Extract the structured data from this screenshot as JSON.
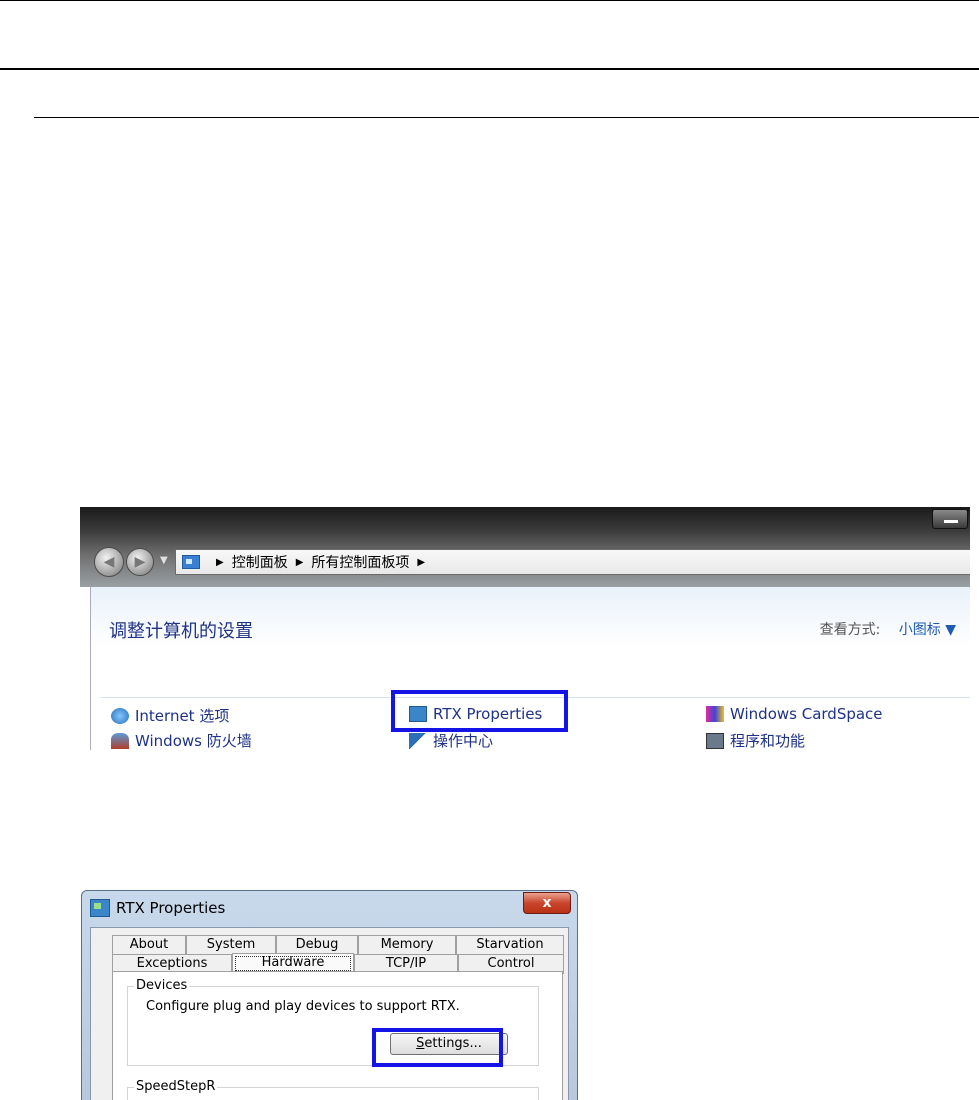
{
  "control_panel": {
    "breadcrumb": [
      "控制面板",
      "所有控制面板项"
    ],
    "heading": "调整计算机的设置",
    "view_by_label": "查看方式:",
    "view_by_value": "小图标 ▼",
    "items": [
      {
        "label": "Internet 选项"
      },
      {
        "label": "RTX Properties"
      },
      {
        "label": "Windows CardSpace"
      },
      {
        "label": "Windows 防火墙"
      },
      {
        "label": "操作中心"
      },
      {
        "label": "程序和功能"
      }
    ]
  },
  "dialog": {
    "title": "RTX Properties",
    "close_glyph": "x",
    "tabs_row1": [
      "About",
      "System",
      "Debug",
      "Memory",
      "Starvation"
    ],
    "tabs_row2": [
      "Exceptions",
      "Hardware",
      "TCP/IP",
      "Control"
    ],
    "active_tab": "Hardware",
    "devices_group": "Devices",
    "devices_desc": "Configure plug and play devices to support RTX.",
    "settings_mnemonic": "S",
    "settings_rest": "ettings...",
    "speedstep_group": "SpeedStepR"
  },
  "colors": {
    "highlight": "#1414e6",
    "link": "#1e3287"
  }
}
